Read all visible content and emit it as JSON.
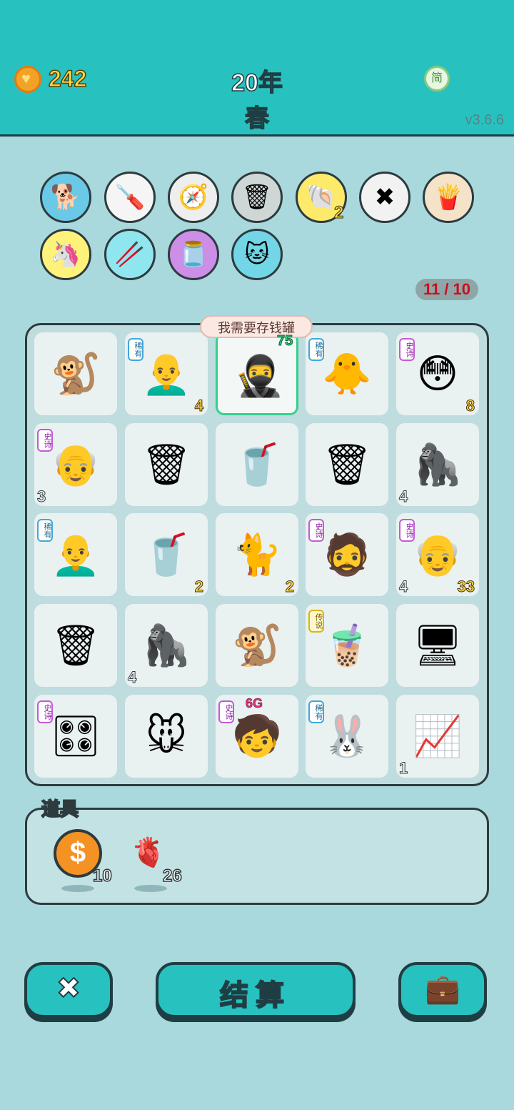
{
  "header": {
    "coins": "242",
    "year": "20年",
    "season": "春",
    "lang_button": "简",
    "version": "v3.6.6"
  },
  "item_row": [
    {
      "name": "dog-icon",
      "emoji": "🐕",
      "bg": "#69c9e6"
    },
    {
      "name": "screwdriver-icon",
      "emoji": "🪛",
      "bg": "#f5f5f5"
    },
    {
      "name": "compass-icon",
      "emoji": "🧭",
      "bg": "#eeeeee"
    },
    {
      "name": "trash-recycle-icon",
      "emoji": "🗑",
      "bg": "#cfd6d6"
    },
    {
      "name": "shell-icon",
      "emoji": "🐚",
      "bg": "#fde96a",
      "count": "2"
    },
    {
      "name": "delete-tag-icon",
      "emoji": "✖",
      "bg": "#f2f2f2"
    },
    {
      "name": "fries-icon",
      "emoji": "🍟",
      "bg": "#f4e3c9"
    },
    {
      "name": "unicorn-icon",
      "emoji": "🦄",
      "bg": "#fff27a"
    },
    {
      "name": "chopsticks-icon",
      "emoji": "🥢",
      "bg": "#8fe6ef"
    },
    {
      "name": "jar-icon",
      "emoji": "🫙",
      "bg": "#cc8ee6"
    },
    {
      "name": "cat-icon",
      "emoji": "🐱",
      "bg": "#72d6e6"
    }
  ],
  "counter": "11 / 10",
  "speech_bubble": "我需要存钱罐",
  "selected_cell_value": "75",
  "grid": [
    {
      "name": "monkey",
      "emoji": "🐒",
      "tag": "",
      "num": "",
      "num_side": ""
    },
    {
      "name": "bald-man",
      "emoji": "👨‍🦲",
      "tag": "稀有",
      "tag_type": "rare",
      "num": "4",
      "num_side": "r"
    },
    {
      "name": "thief",
      "emoji": "🥷",
      "tag": "",
      "num": "",
      "num_side": ""
    },
    {
      "name": "chicken",
      "emoji": "🐥",
      "tag": "稀有",
      "tag_type": "rare",
      "num": "",
      "num_side": ""
    },
    {
      "name": "yellow-face",
      "emoji": "😳",
      "tag": "史诗",
      "tag_type": "epic",
      "num": "8",
      "num_side": "r"
    },
    {
      "name": "old-man",
      "emoji": "👴",
      "tag": "史诗",
      "tag_type": "epic",
      "num": "3",
      "num_side": "l"
    },
    {
      "name": "trash-bag",
      "emoji": "🗑",
      "tag": "",
      "num": "",
      "num_side": ""
    },
    {
      "name": "cup",
      "emoji": "🥤",
      "tag": "",
      "num": "",
      "num_side": ""
    },
    {
      "name": "trash-bag",
      "emoji": "🗑",
      "tag": "",
      "num": "",
      "num_side": ""
    },
    {
      "name": "gorilla",
      "emoji": "🦍",
      "tag": "",
      "num": "4",
      "num_side": "l"
    },
    {
      "name": "bald-man",
      "emoji": "👨‍🦲",
      "tag": "稀有",
      "tag_type": "rare",
      "num": "",
      "num_side": ""
    },
    {
      "name": "soda-cup",
      "emoji": "🥤",
      "tag": "",
      "num": "2",
      "num_side": "r"
    },
    {
      "name": "yellow-cat",
      "emoji": "🐈",
      "tag": "",
      "num": "2",
      "num_side": "r"
    },
    {
      "name": "bearded-man",
      "emoji": "🧔",
      "tag": "史诗",
      "tag_type": "epic",
      "num": "",
      "num_side": ""
    },
    {
      "name": "old-man-wedding",
      "emoji": "👴",
      "tag": "史诗",
      "tag_type": "epic",
      "num": "4",
      "num_side": "l",
      "num2": "33"
    },
    {
      "name": "trash-bag",
      "emoji": "🗑",
      "tag": "",
      "num": "",
      "num_side": ""
    },
    {
      "name": "gorilla",
      "emoji": "🦍",
      "tag": "",
      "num": "4",
      "num_side": "l"
    },
    {
      "name": "monkey",
      "emoji": "🐒",
      "tag": "",
      "num": "",
      "num_side": ""
    },
    {
      "name": "bubble-tea",
      "emoji": "🧋",
      "tag": "传说",
      "tag_type": "legend",
      "num": "",
      "num_side": ""
    },
    {
      "name": "computer",
      "emoji": "🖥",
      "tag": "",
      "num": "",
      "num_side": ""
    },
    {
      "name": "graphics-card",
      "emoji": "🎛",
      "tag": "史诗",
      "tag_type": "epic",
      "num": "",
      "num_side": ""
    },
    {
      "name": "mouse",
      "emoji": "🐭",
      "tag": "",
      "num": "",
      "num_side": ""
    },
    {
      "name": "boy-6g",
      "emoji": "🧒",
      "tag": "史诗",
      "tag_type": "epic",
      "num": "",
      "num_side": "",
      "label": "6G"
    },
    {
      "name": "rabbit",
      "emoji": "🐰",
      "tag": "稀有",
      "tag_type": "rare",
      "num": "",
      "num_side": ""
    },
    {
      "name": "stock-chart",
      "emoji": "📈",
      "tag": "",
      "num": "1",
      "num_side": "l"
    }
  ],
  "tools": {
    "title": "道具",
    "coin_symbol": "$",
    "coin_count": "10",
    "liver_count": "26"
  },
  "buttons": {
    "delete_symbol": "✖",
    "settle_label": "结算",
    "briefcase_symbol": "💼"
  }
}
